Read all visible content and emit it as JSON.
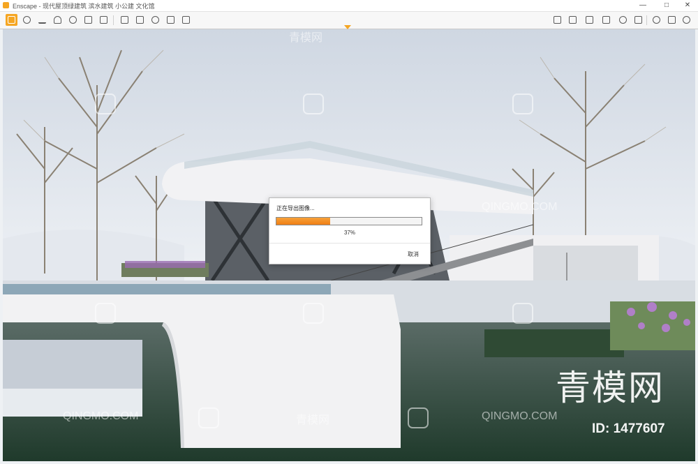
{
  "window": {
    "app_name": "Enscape",
    "title": "Enscape - 现代屋顶绿建筑 滨水建筑 小公建 文化馆",
    "minimize_glyph": "—",
    "maximize_glyph": "□",
    "close_glyph": "✕"
  },
  "toolbar": {
    "left_icons": [
      "home-icon",
      "pen-icon",
      "text-icon",
      "user-icon",
      "binoculars-icon",
      "books-icon",
      "box-icon",
      "compass-icon",
      "capture-icon",
      "image-export-icon",
      "panorama-icon",
      "video-export-icon",
      "batch-icon",
      "link-icon"
    ],
    "right_icons": [
      "asset-library-icon",
      "material-icon",
      "window-icon",
      "cube-icon",
      "sky-icon",
      "vr-icon",
      "eye-settings-icon",
      "help-icon"
    ],
    "accent": "#f5a623"
  },
  "export_dialog": {
    "title": "正在导出图像...",
    "progress_percent_label": "37%",
    "progress_fraction": 0.37,
    "cancel_label": "取消",
    "fill_color": "#f08a1c"
  },
  "watermarks": {
    "brand_cn": "青模网",
    "brand_en": "QINGMO.COM",
    "big": "青模网",
    "id": "ID: 1477607"
  }
}
